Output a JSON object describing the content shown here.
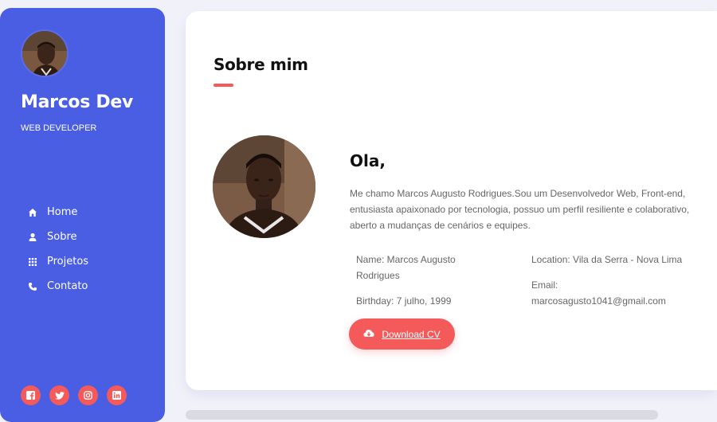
{
  "sidebar": {
    "name": "Marcos Dev",
    "role": "WEB DEVELOPER",
    "nav": [
      {
        "label": "Home",
        "icon": "home-icon"
      },
      {
        "label": "Sobre",
        "icon": "user-icon"
      },
      {
        "label": "Projetos",
        "icon": "grid-icon"
      },
      {
        "label": "Contato",
        "icon": "phone-icon"
      }
    ],
    "socials": [
      "facebook-icon",
      "twitter-icon",
      "instagram-icon",
      "linkedin-icon"
    ]
  },
  "about": {
    "title": "Sobre mim",
    "greeting": "Ola,",
    "bio": "Me chamo Marcos Augusto Rodrigues.Sou um Desenvolvedor Web, Front-end, entusiasta apaixonado por tecnologia, possuo um perfil resiliente e colaborativo, aberto a mudanças de cenários e equipes.",
    "name_line": "Name: Marcos Augusto Rodrigues",
    "birthday_line": "Birthday: 7 julho, 1999",
    "location_line": "Location: Vila da Serra - Nova Lima",
    "email_line": "Email: marcosagusto1041@gmail.com",
    "download_label": "Download CV"
  },
  "colors": {
    "primary": "#4a5ee4",
    "accent": "#f55a5a",
    "background": "#f1f2f9"
  }
}
